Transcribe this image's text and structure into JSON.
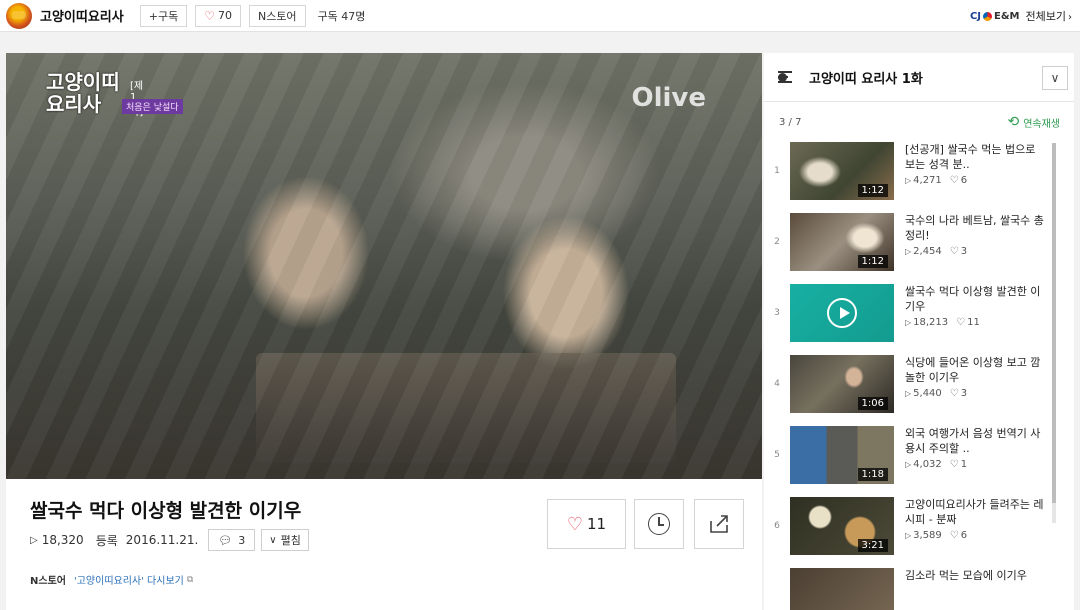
{
  "header": {
    "channel_name": "고양이띠요리사",
    "subscribe_label": "+구독",
    "like_count": "70",
    "nstore_label": "N스토어",
    "subscriber_text": "구독 47명",
    "company_logo_text": "CJ E&M",
    "view_all_label": "전체보기"
  },
  "video": {
    "show_title": "고양이띠 요리사",
    "episode_tag": "[제1화]",
    "episode_subtitle": "처음은 낯설다",
    "channel_watermark": "Olive"
  },
  "info": {
    "title": "쌀국수 먹다 이상형 발견한 이기우",
    "views": "18,320",
    "date_label": "등록",
    "date": "2016.11.21.",
    "comment_count": "3",
    "expand_label": "펼침",
    "like_count": "11",
    "source_brand": "N스토어",
    "source_link": "'고양이띠요리사' 다시보기"
  },
  "playlist": {
    "title": "고양이띠 요리사 1화",
    "position": "3 / 7",
    "autoplay_label": "연속재생",
    "items": [
      {
        "index": "1",
        "title": "[선공개] 쌀국수 먹는 법으로 보는 성격 분..",
        "duration": "1:12",
        "views": "4,271",
        "likes": "6"
      },
      {
        "index": "2",
        "title": "국수의 나라 베트남, 쌀국수 총정리!",
        "duration": "1:12",
        "views": "2,454",
        "likes": "3"
      },
      {
        "index": "3",
        "title": "쌀국수 먹다 이상형 발견한 이기우",
        "duration": "",
        "views": "18,213",
        "likes": "11"
      },
      {
        "index": "4",
        "title": "식당에 들어온 이상형 보고 깜놀한 이기우",
        "duration": "1:06",
        "views": "5,440",
        "likes": "3"
      },
      {
        "index": "5",
        "title": "외국 여행가서 음성 번역기 사용시 주의할 ..",
        "duration": "1:18",
        "views": "4,032",
        "likes": "1"
      },
      {
        "index": "6",
        "title": "고양이띠요리사가 들려주는 레시피 - 분짜",
        "duration": "3:21",
        "views": "3,589",
        "likes": "6"
      },
      {
        "index": "",
        "title": "김소라 먹는 모습에 이기우",
        "duration": "",
        "views": "",
        "likes": ""
      }
    ]
  },
  "colors": {
    "accent_green": "#2c9b4f",
    "heart_red": "#e34b5c",
    "link_blue": "#2a6fb8"
  }
}
